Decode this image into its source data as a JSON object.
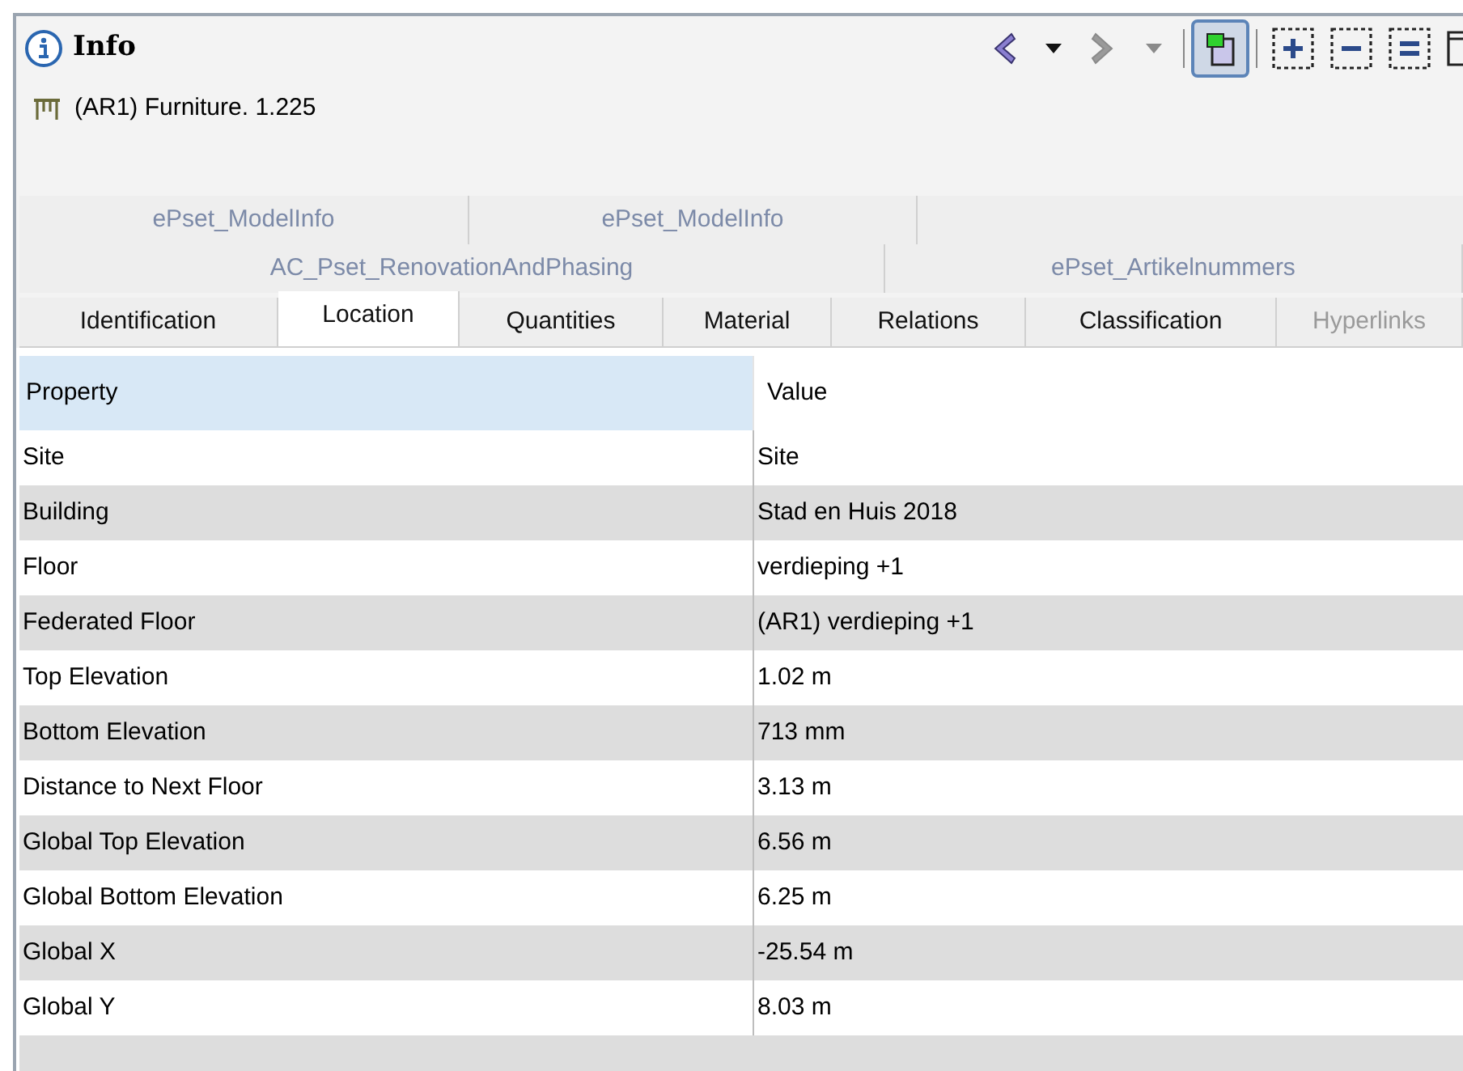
{
  "panel": {
    "title": "Info"
  },
  "toolbar": [
    {
      "kind": "back",
      "disabled": false
    },
    {
      "kind": "dropdown",
      "disabled": false
    },
    {
      "kind": "forward",
      "disabled": true
    },
    {
      "kind": "dropdown",
      "disabled": true
    },
    {
      "kind": "toggle",
      "pressed": true
    },
    {
      "kind": "expand"
    },
    {
      "kind": "collapse"
    },
    {
      "kind": "list"
    },
    {
      "kind": "window"
    }
  ],
  "object": {
    "name": "(AR1) Furniture. 1.225"
  },
  "tab_rows": [
    [
      {
        "label": "ePset_ModelInfo",
        "selected": false,
        "disabled": false
      },
      {
        "label": "ePset_ModelInfo",
        "selected": false,
        "disabled": false
      }
    ],
    [
      {
        "label": "AC_Pset_RenovationAndPhasing",
        "selected": false,
        "disabled": false
      },
      {
        "label": "ePset_Artikelnummers",
        "selected": false,
        "disabled": false
      }
    ],
    [
      {
        "label": "Identification",
        "selected": false,
        "disabled": false
      },
      {
        "label": "Location",
        "selected": true,
        "disabled": false
      },
      {
        "label": "Quantities",
        "selected": false,
        "disabled": false
      },
      {
        "label": "Material",
        "selected": false,
        "disabled": false
      },
      {
        "label": "Relations",
        "selected": false,
        "disabled": false
      },
      {
        "label": "Classification",
        "selected": false,
        "disabled": false
      },
      {
        "label": "Hyperlinks",
        "selected": false,
        "disabled": true
      }
    ]
  ],
  "table": {
    "columns": [
      "Property",
      "Value"
    ],
    "rows": [
      [
        "Site",
        "Site"
      ],
      [
        "Building",
        "Stad en Huis 2018"
      ],
      [
        "Floor",
        "verdieping +1"
      ],
      [
        "Federated Floor",
        "(AR1) verdieping +1"
      ],
      [
        "Top Elevation",
        "1.02 m"
      ],
      [
        "Bottom Elevation",
        "713 mm"
      ],
      [
        "Distance to Next Floor",
        "3.13 m"
      ],
      [
        "Global Top Elevation",
        "6.56 m"
      ],
      [
        "Global Bottom Elevation",
        "6.25 m"
      ],
      [
        "Global X",
        "-25.54 m"
      ],
      [
        "Global Y",
        "8.03 m"
      ]
    ]
  }
}
